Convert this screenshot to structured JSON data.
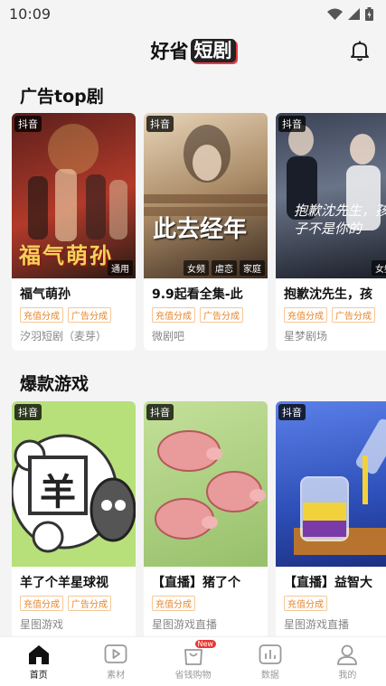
{
  "status": {
    "time": "10:09"
  },
  "header": {
    "logo_left": "好省",
    "logo_box": "短剧"
  },
  "sections": [
    {
      "title": "广告top剧",
      "cards": [
        {
          "badge": "抖音",
          "poster_tags": [
            "通用"
          ],
          "poster_text": "福气萌孙",
          "title": "福气萌孙",
          "chips": [
            "充值分成",
            "广告分成"
          ],
          "source": "汐羽短剧（麦芽）",
          "colors": [
            "#5a1f1b",
            "#b23a2a",
            "#2a1a14"
          ]
        },
        {
          "badge": "抖音",
          "poster_tags": [
            "女频",
            "虐恋",
            "家庭"
          ],
          "poster_text": "此去经年",
          "title": "9.9起看全集-此",
          "chips": [
            "充值分成",
            "广告分成"
          ],
          "source": "微剧吧",
          "colors": [
            "#d9c2a3",
            "#8a6a4a",
            "#3a2a1e"
          ]
        },
        {
          "badge": "抖音",
          "poster_tags": [
            "女频"
          ],
          "poster_text": "抱歉沈先生，孩子不是你的",
          "title": "抱歉沈先生，孩",
          "chips": [
            "充值分成",
            "广告分成"
          ],
          "source": "星梦剧场",
          "colors": [
            "#2c3344",
            "#58647a",
            "#1a1e28"
          ]
        }
      ]
    },
    {
      "title": "爆款游戏",
      "cards": [
        {
          "badge": "抖音",
          "poster_tags": [],
          "poster_text": "羊",
          "title": "羊了个羊星球视",
          "chips": [
            "充值分成",
            "广告分成"
          ],
          "source": "星图游戏",
          "colors": [
            "#b7e07a",
            "#8bc34a",
            "#6a9a34"
          ]
        },
        {
          "badge": "抖音",
          "poster_tags": [],
          "poster_text": "",
          "title": "【直播】猪了个",
          "chips": [
            "充值分成"
          ],
          "source": "星图游戏直播",
          "colors": [
            "#b6d78e",
            "#97c06b",
            "#7aa552"
          ]
        },
        {
          "badge": "抖音",
          "poster_tags": [],
          "poster_text": "",
          "title": "【直播】益智大",
          "chips": [
            "充值分成"
          ],
          "source": "星图游戏直播",
          "colors": [
            "#4a6fd8",
            "#2d4fb8",
            "#1c2f80"
          ]
        }
      ]
    }
  ],
  "nav": [
    {
      "label": "首页",
      "icon": "home-icon",
      "active": true
    },
    {
      "label": "素材",
      "icon": "play-icon",
      "active": false
    },
    {
      "label": "省钱购物",
      "icon": "shopping-bag-icon",
      "active": false,
      "badge": "New"
    },
    {
      "label": "数据",
      "icon": "chart-icon",
      "active": false
    },
    {
      "label": "我的",
      "icon": "user-icon",
      "active": false
    }
  ],
  "accent_color": "#e7862c"
}
